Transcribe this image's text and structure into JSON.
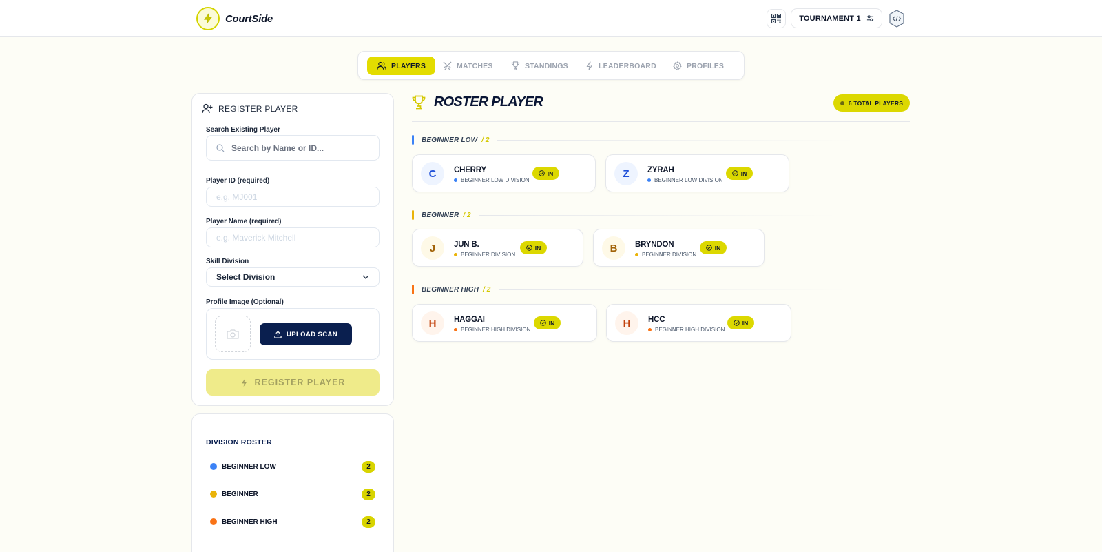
{
  "app": {
    "name": "CourtSide"
  },
  "header": {
    "tournament_label": "TOURNAMENT 1"
  },
  "tabs": [
    {
      "label": "PLAYERS",
      "icon": "users-icon",
      "active": true
    },
    {
      "label": "MATCHES",
      "icon": "swords-icon",
      "active": false
    },
    {
      "label": "STANDINGS",
      "icon": "trophy-icon",
      "active": false
    },
    {
      "label": "LEADERBOARD",
      "icon": "bolt-icon",
      "active": false
    },
    {
      "label": "PROFILES",
      "icon": "gear-icon",
      "active": false
    }
  ],
  "register": {
    "title": "REGISTER PLAYER",
    "search_label": "Search Existing Player",
    "search_placeholder": "Search by Name or ID...",
    "id_label": "Player ID (required)",
    "id_placeholder": "e.g. MJ001",
    "name_label": "Player Name (required)",
    "name_placeholder": "e.g. Maverick Mitchell",
    "division_label": "Skill Division",
    "division_value": "Select Division",
    "image_label": "Profile Image (Optional)",
    "upload_label": "UPLOAD SCAN",
    "submit_label": "REGISTER PLAYER"
  },
  "division_roster": {
    "title": "DIVISION ROSTER",
    "items": [
      {
        "label": "BEGINNER LOW",
        "count": "2",
        "color": "#3b82f6"
      },
      {
        "label": "BEGINNER",
        "count": "2",
        "color": "#eab308"
      },
      {
        "label": "BEGINNER HIGH",
        "count": "2",
        "color": "#f97316"
      }
    ]
  },
  "roster": {
    "title": "ROSTER PLAYER",
    "total_label": "6 TOTAL PLAYERS",
    "sections": [
      {
        "name": "BEGINNER LOW",
        "count_label": "/ 2",
        "color": "#3b82f6",
        "players": [
          {
            "initial": "C",
            "name": "CHERRY",
            "division": "BEGINNER LOW DIVISION",
            "status": "IN"
          },
          {
            "initial": "Z",
            "name": "ZYRAH",
            "division": "BEGINNER LOW DIVISION",
            "status": "IN"
          }
        ]
      },
      {
        "name": "BEGINNER",
        "count_label": "/ 2",
        "color": "#eab308",
        "players": [
          {
            "initial": "J",
            "name": "JUN B.",
            "division": "BEGINNER DIVISION",
            "status": "IN"
          },
          {
            "initial": "B",
            "name": "BRYNDON",
            "division": "BEGINNER DIVISION",
            "status": "IN"
          }
        ]
      },
      {
        "name": "BEGINNER HIGH",
        "count_label": "/ 2",
        "color": "#f97316",
        "players": [
          {
            "initial": "H",
            "name": "HAGGAI",
            "division": "BEGINNER HIGH DIVISION",
            "status": "IN"
          },
          {
            "initial": "H",
            "name": "HCC",
            "division": "BEGINNER HIGH DIVISION",
            "status": "IN"
          }
        ]
      }
    ]
  }
}
